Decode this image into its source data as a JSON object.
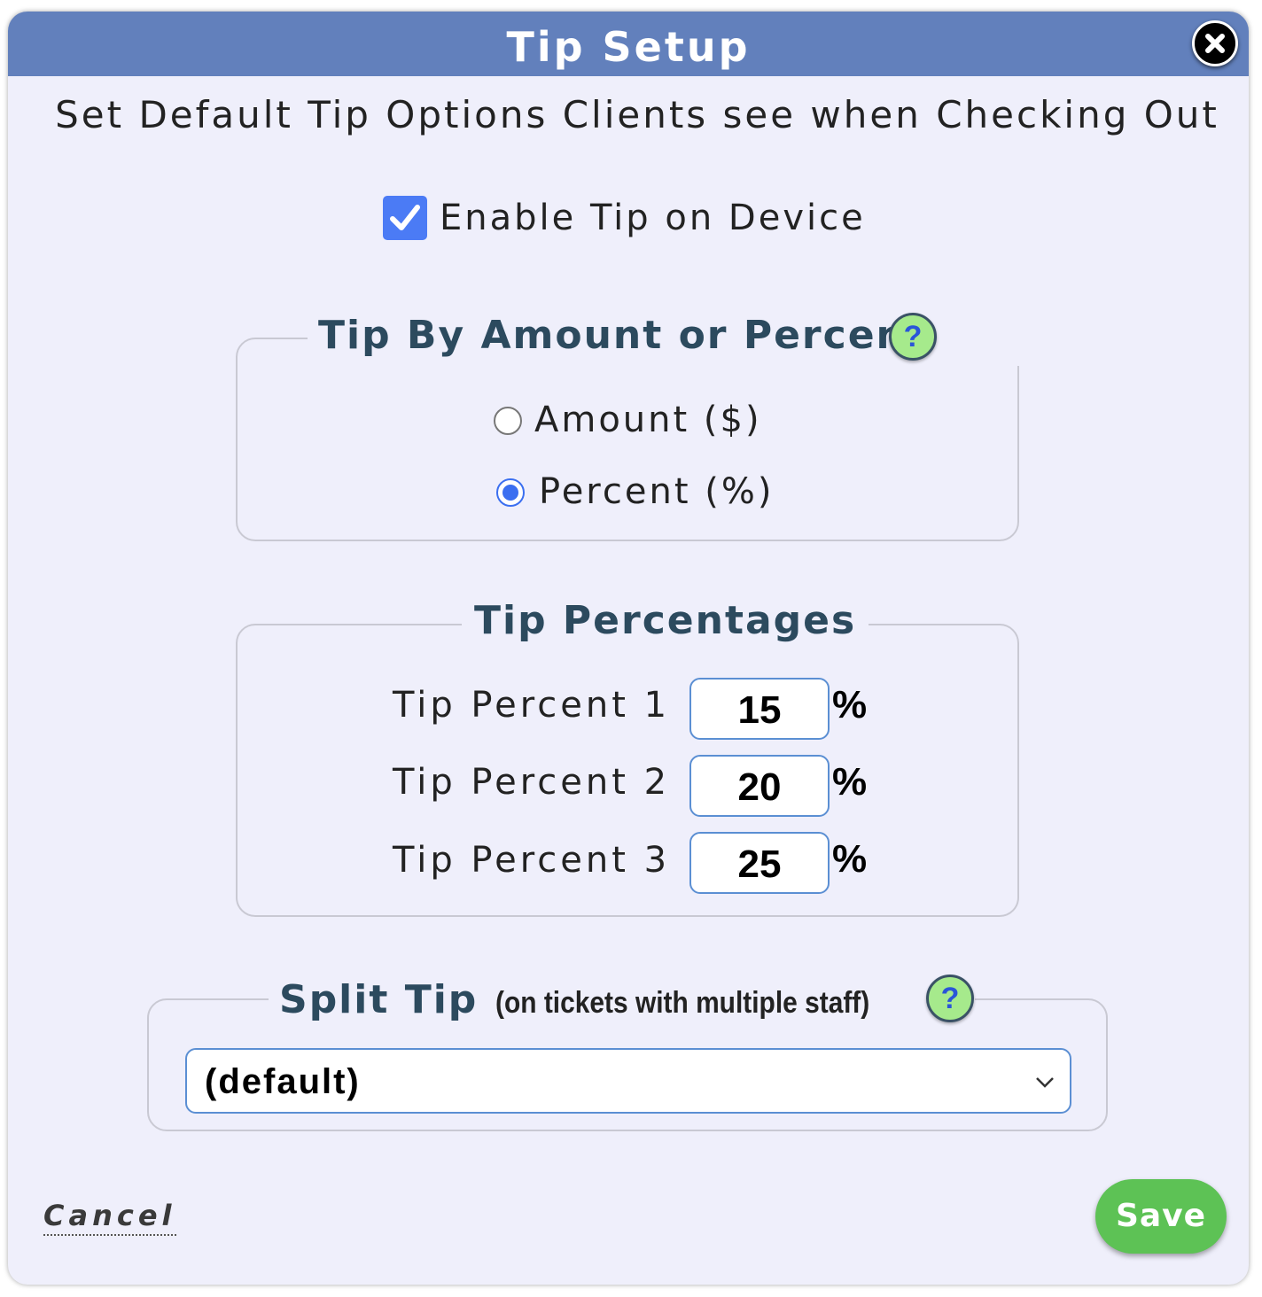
{
  "dialog": {
    "title": "Tip Setup",
    "subtitle": "Set Default Tip Options Clients see when Checking Out",
    "close_icon": "close-icon"
  },
  "enable_tip": {
    "label": "Enable Tip on Device",
    "checked": true
  },
  "tip_mode": {
    "legend": "Tip By Amount or Percent",
    "help": "?",
    "options": [
      {
        "label": "Amount ($)",
        "selected": false
      },
      {
        "label": "Percent (%)",
        "selected": true
      }
    ]
  },
  "tip_percentages": {
    "legend": "Tip Percentages",
    "rows": [
      {
        "label": "Tip Percent 1",
        "value": "15",
        "unit": "%"
      },
      {
        "label": "Tip Percent 2",
        "value": "20",
        "unit": "%"
      },
      {
        "label": "Tip Percent 3",
        "value": "25",
        "unit": "%"
      }
    ]
  },
  "split_tip": {
    "legend": "Split Tip",
    "legend_note": "(on tickets with multiple staff)",
    "help": "?",
    "selected": "(default)"
  },
  "footer": {
    "cancel": "Cancel",
    "save": "Save"
  },
  "colors": {
    "titlebar": "#6280bc",
    "background": "#efeffb",
    "accent": "#4b7bf5",
    "save": "#5dc255",
    "help": "#a6ea8c"
  }
}
